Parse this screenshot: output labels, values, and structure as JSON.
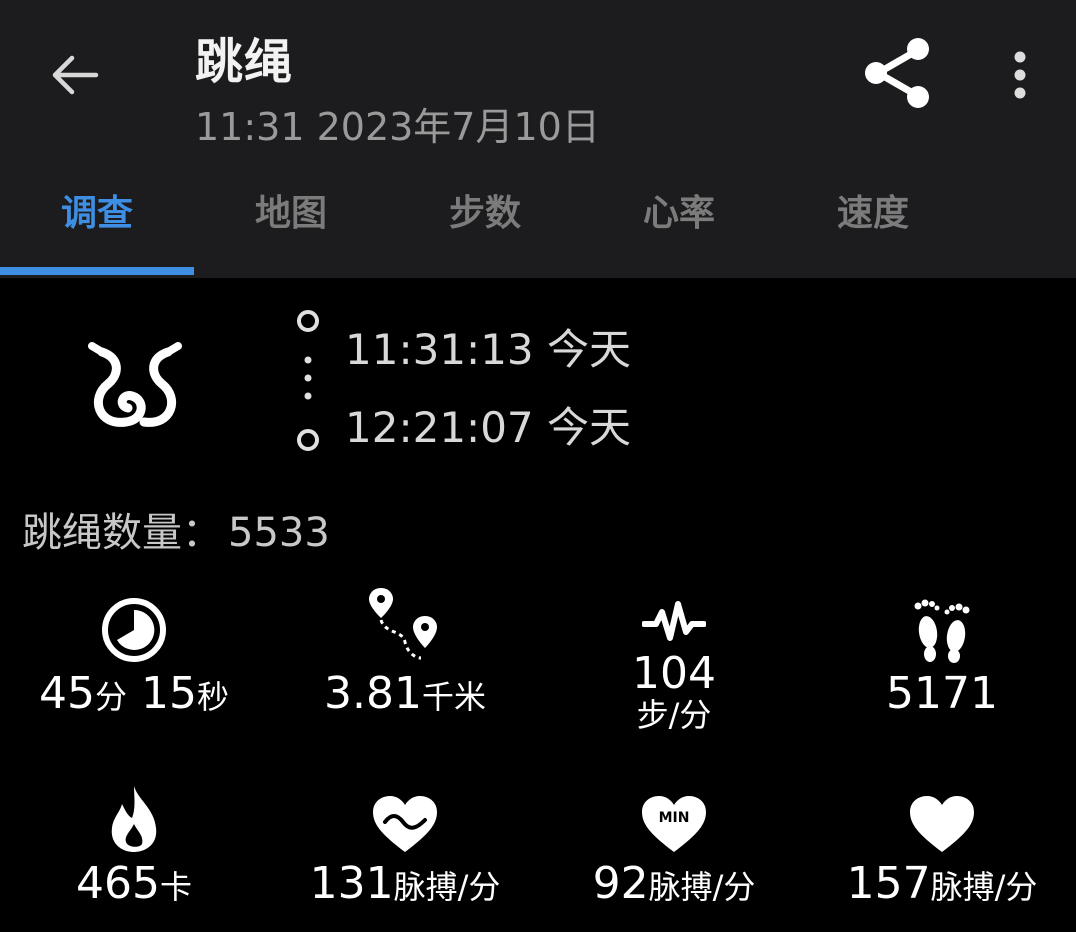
{
  "header": {
    "title": "跳绳",
    "subtitle": "11:31 2023年7月10日"
  },
  "tabs": [
    {
      "label": "调查",
      "active": true
    },
    {
      "label": "地图",
      "active": false
    },
    {
      "label": "步数",
      "active": false
    },
    {
      "label": "心率",
      "active": false
    },
    {
      "label": "速度",
      "active": false
    }
  ],
  "summary": {
    "activity_icon": "jump-rope-icon",
    "start_time": "11:31:13 今天",
    "end_time": "12:21:07 今天",
    "count_label": "跳绳数量：",
    "count_value": "5533"
  },
  "stats": {
    "duration": {
      "icon": "timer-icon",
      "min_value": "45",
      "min_unit": "分",
      "sec_value": "15",
      "sec_unit": "秒"
    },
    "distance": {
      "icon": "route-icon",
      "value": "3.81",
      "unit": "千米"
    },
    "cadence": {
      "icon": "pulse-wave-icon",
      "value": "104",
      "unit": "步/分"
    },
    "steps": {
      "icon": "footprints-icon",
      "value": "5171"
    },
    "calories": {
      "icon": "flame-icon",
      "value": "465",
      "unit": "卡"
    },
    "avg_hr": {
      "icon": "heart-wave-icon",
      "value": "131",
      "unit": "脉搏/分"
    },
    "min_hr": {
      "icon": "heart-min-icon",
      "badge": "MIN",
      "value": "92",
      "unit": "脉搏/分"
    },
    "max_hr": {
      "icon": "heart-icon",
      "value": "157",
      "unit": "脉搏/分"
    }
  },
  "colors": {
    "accent": "#3e8ee4",
    "appbar": "#1c1c1e",
    "background": "#000000"
  }
}
